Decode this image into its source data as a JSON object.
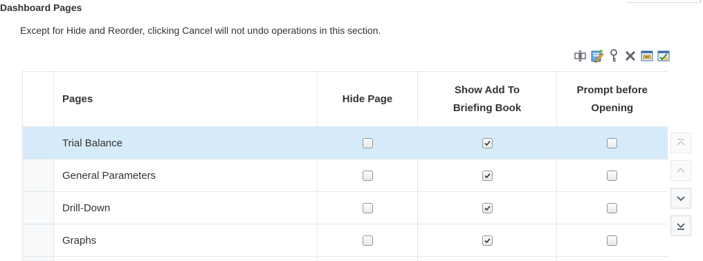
{
  "section": {
    "title": "Dashboard Pages",
    "note": "Except for Hide and Reorder, clicking Cancel will not undo operations in this section."
  },
  "toolbar": {
    "buttons": [
      {
        "icon": "rename-icon"
      },
      {
        "icon": "edit-properties-icon"
      },
      {
        "icon": "permissions-key-icon"
      },
      {
        "icon": "delete-icon"
      },
      {
        "icon": "print-options-icon"
      },
      {
        "icon": "report-links-icon"
      }
    ]
  },
  "table": {
    "headers": {
      "pages": "Pages",
      "hide_page": "Hide Page",
      "show_add_line1": "Show Add To",
      "show_add_line2": "Briefing Book",
      "prompt_line1": "Prompt before",
      "prompt_line2": "Opening"
    },
    "rows": [
      {
        "name": "Trial Balance",
        "hide": false,
        "show_add": true,
        "prompt": false,
        "selected": true
      },
      {
        "name": "General Parameters",
        "hide": false,
        "show_add": true,
        "prompt": false,
        "selected": false
      },
      {
        "name": "Drill-Down",
        "hide": false,
        "show_add": true,
        "prompt": false,
        "selected": false
      },
      {
        "name": "Graphs",
        "hide": false,
        "show_add": true,
        "prompt": false,
        "selected": false
      }
    ]
  },
  "reorder": {
    "move_top_enabled": false,
    "move_up_enabled": false,
    "move_down_enabled": true,
    "move_bottom_enabled": true
  },
  "colors": {
    "selected_row": "#d6ebfa",
    "grid_line": "#e3e7ea",
    "icon_gray": "#5a6470"
  }
}
